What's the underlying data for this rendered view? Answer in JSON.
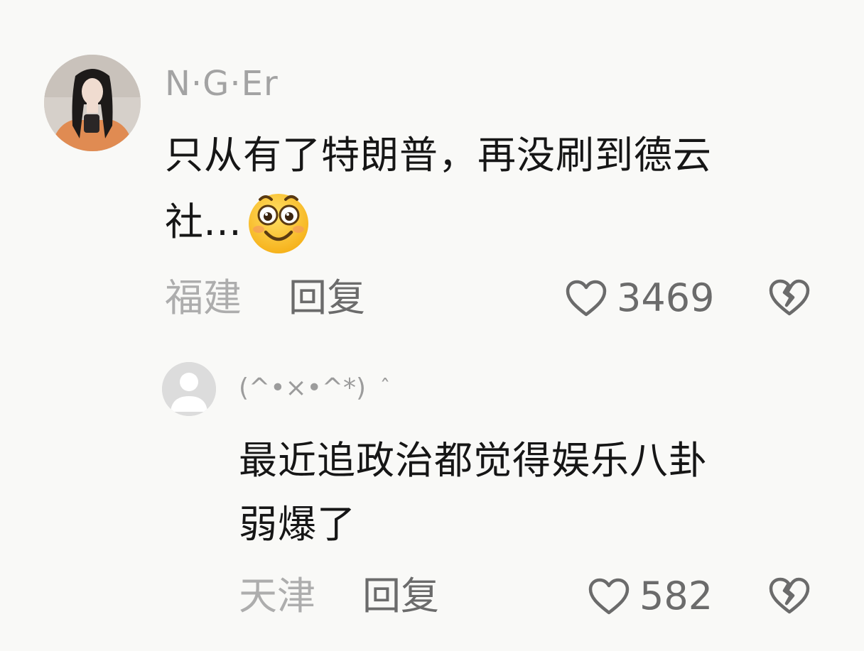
{
  "comments": [
    {
      "username": "N·G·Er",
      "text_line1": "只从有了特朗普，再没刷到德云",
      "text_line2": "社…",
      "emoji_icon": "smiling-emoji-icon",
      "location": "福建",
      "reply_label": "回复",
      "like_count": "3469"
    },
    {
      "username": "(^•×•^*)",
      "username_extra": "ˆ",
      "text_line1": "最近追政治都觉得娱乐八卦",
      "text_line2": "弱爆了",
      "location": "天津",
      "reply_label": "回复",
      "like_count": "582"
    }
  ],
  "colors": {
    "background": "#f9f9f7",
    "username": "#a3a3a3",
    "text": "#161616",
    "meta": "#6b6b6b",
    "location": "#adadad"
  }
}
